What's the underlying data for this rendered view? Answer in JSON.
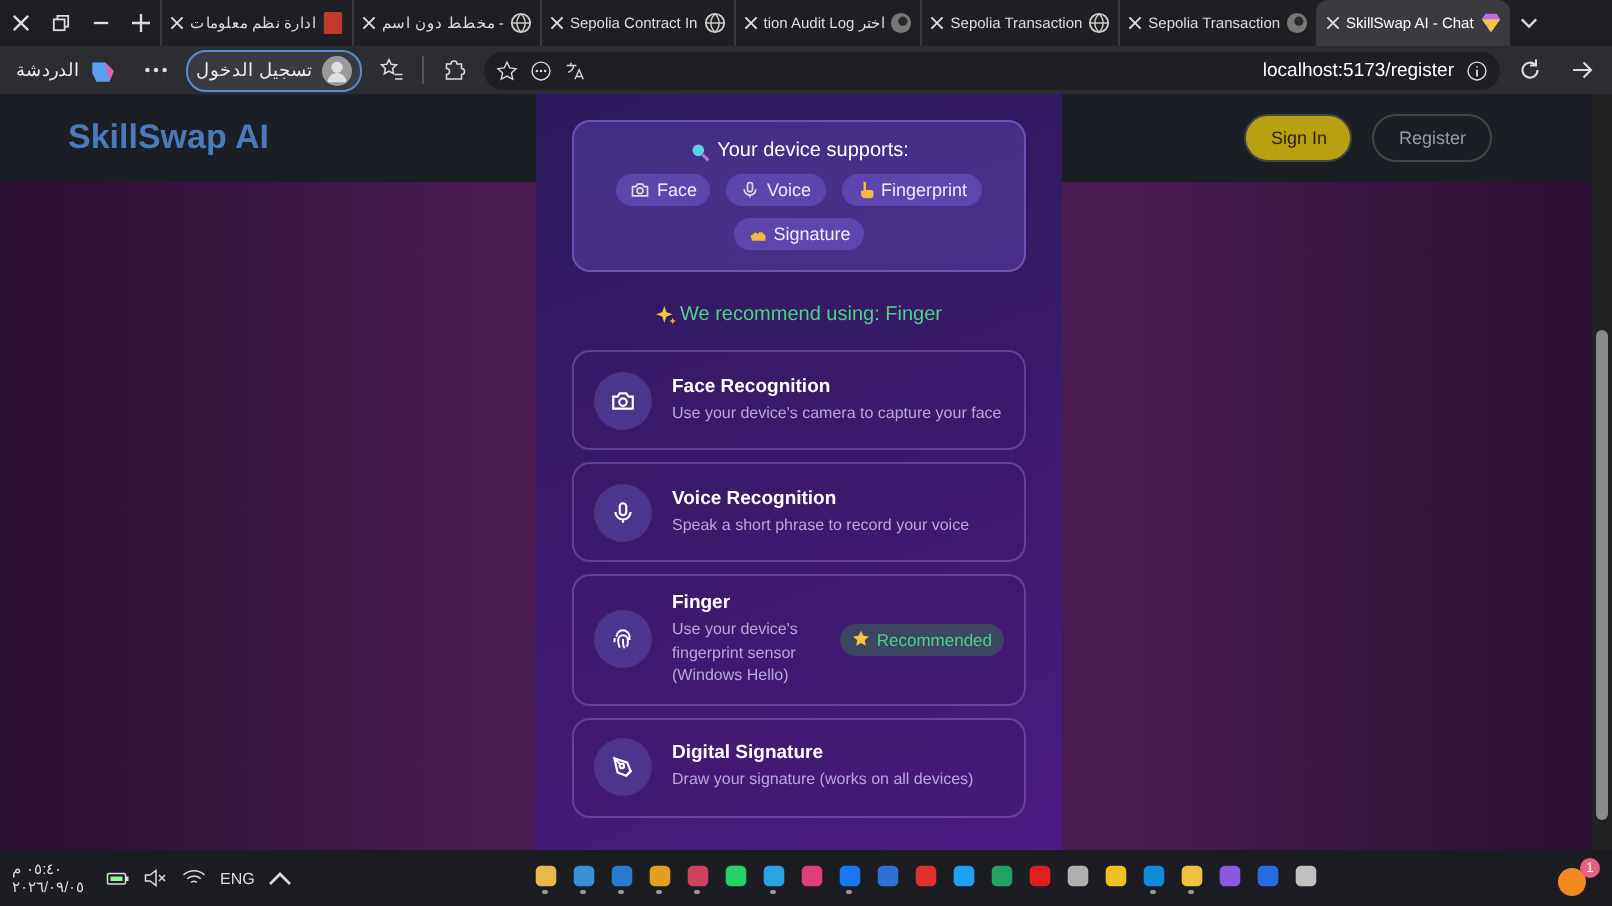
{
  "browser": {
    "tabs": [
      {
        "label": "ادارة نظم معلومات",
        "selected": false
      },
      {
        "label": "مخطط دون اسم -",
        "selected": false
      },
      {
        "label": "Sepolia Contract In",
        "selected": false
      },
      {
        "label": "tion Audit Log اختر",
        "selected": false
      },
      {
        "label": "Sepolia Transaction",
        "selected": false
      },
      {
        "label": "Sepolia Transaction",
        "selected": false
      },
      {
        "label": "SkillSwap AI - Chat",
        "selected": true
      }
    ],
    "copilot_label": "الدردشة",
    "profile_label": "تسجيل الدخول",
    "address": "localhost:5173/register"
  },
  "background_header": {
    "brand": "SkillSwap AI",
    "buttons": [
      "Sign In",
      "Register"
    ]
  },
  "supports": {
    "title": "Your device supports:",
    "chips": [
      {
        "label": "Face",
        "kind": "camera"
      },
      {
        "label": "Voice",
        "kind": "mic"
      },
      {
        "label": "Fingerprint",
        "kind": "hand"
      },
      {
        "label": "Signature",
        "kind": "write"
      }
    ]
  },
  "recommendation": "We recommend using: Finger",
  "methods": [
    {
      "title": "Face Recognition",
      "description": "Use your device's camera to capture your face",
      "kind": "camera",
      "recommended": false
    },
    {
      "title": "Voice Recognition",
      "description": "Speak a short phrase to record your voice",
      "kind": "mic",
      "recommended": false
    },
    {
      "title": "Finger",
      "description": "Use your device's fingerprint sensor (Windows Hello)",
      "kind": "fingerprint",
      "recommended": true
    },
    {
      "title": "Digital Signature",
      "description": "Draw your signature (works on all devices)",
      "kind": "pen",
      "recommended": false
    }
  ],
  "recommended_badge": "Recommended",
  "taskbar": {
    "time": "٠٥:٤٠ م",
    "date": "٢٠٢٦/٠٩/٠٥",
    "language": "ENG",
    "notification_count": "1",
    "apps": [
      {
        "color": "#e8b84a",
        "running": true
      },
      {
        "color": "#3b8fd9",
        "running": true
      },
      {
        "color": "#2a7ad0",
        "running": true
      },
      {
        "color": "#e0a020",
        "running": true
      },
      {
        "color": "#d04060",
        "running": true
      },
      {
        "color": "#25d366",
        "running": false
      },
      {
        "color": "#2aa3e0",
        "running": true
      },
      {
        "color": "#e0407a",
        "running": false
      },
      {
        "color": "#1877f2",
        "running": true
      },
      {
        "color": "#2f6fd6",
        "running": false
      },
      {
        "color": "#e03030",
        "running": false
      },
      {
        "color": "#1da1f2",
        "running": false
      },
      {
        "color": "#21a366",
        "running": false
      },
      {
        "color": "#e02020",
        "running": false
      },
      {
        "color": "#b0b0b0",
        "running": false
      },
      {
        "color": "#f0c020",
        "running": false
      },
      {
        "color": "#0f8bd8",
        "running": true
      },
      {
        "color": "#f0c040",
        "running": true
      },
      {
        "color": "#8a5ae0",
        "running": false
      },
      {
        "color": "#2a6ae0",
        "running": false
      },
      {
        "color": "#c0c0c0",
        "running": false
      }
    ]
  }
}
